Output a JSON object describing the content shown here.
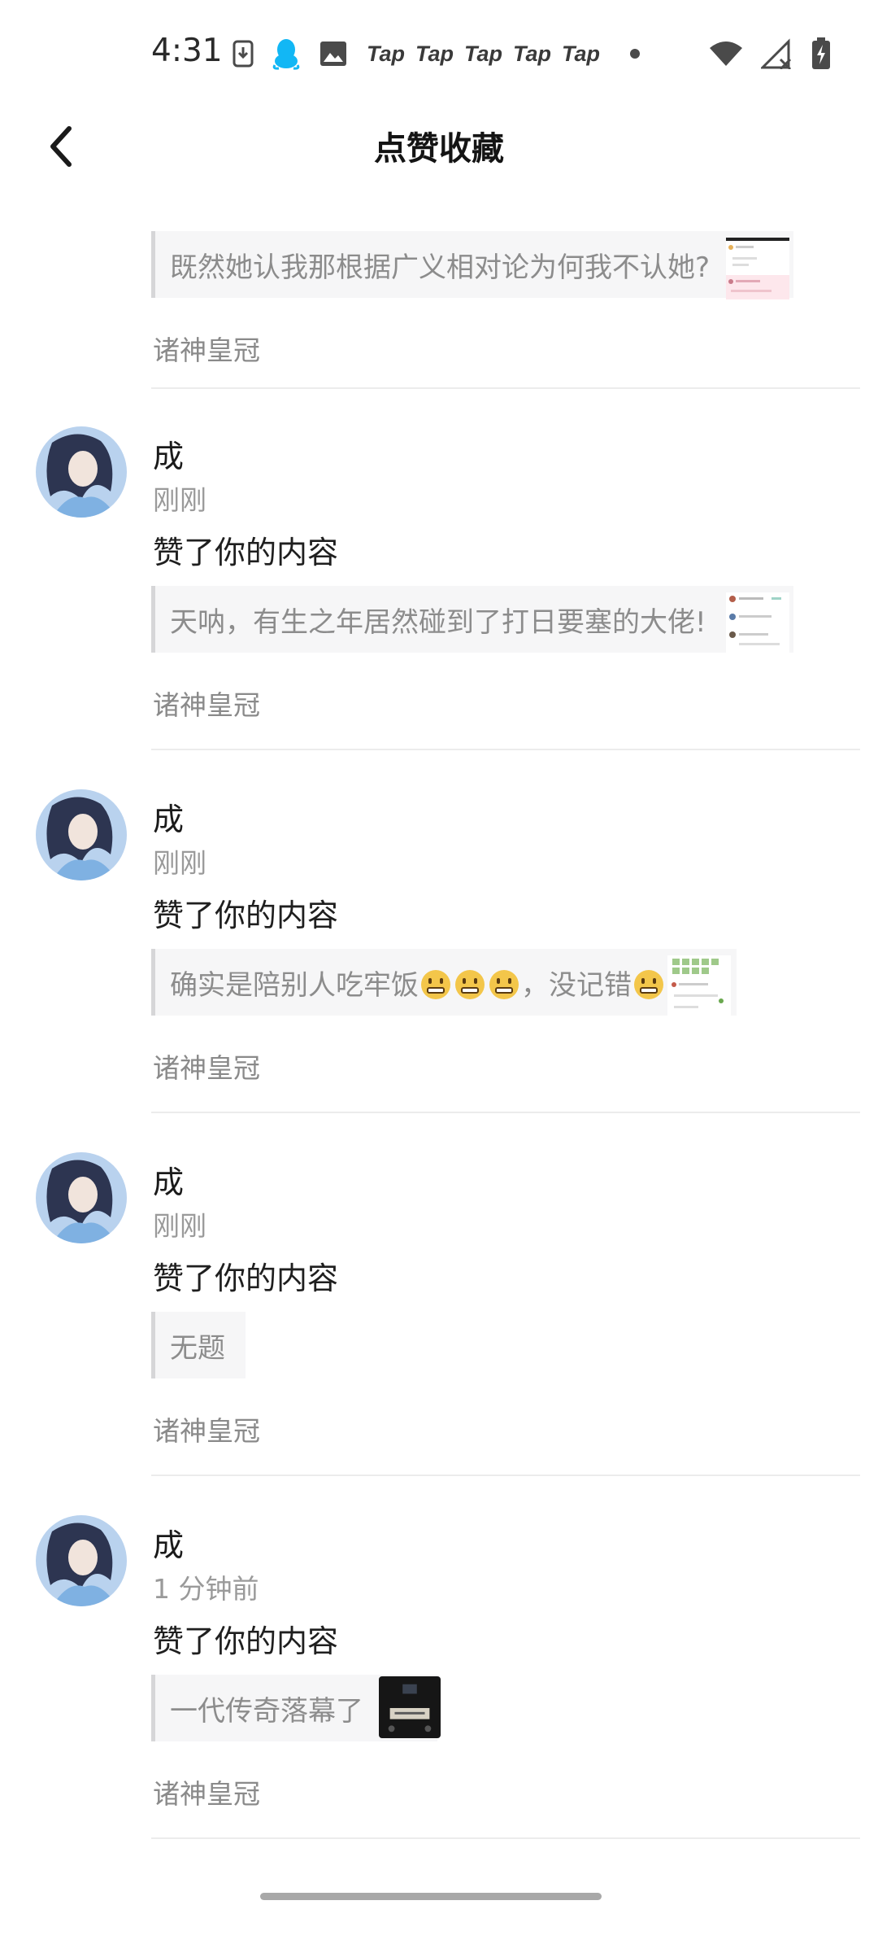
{
  "status_bar": {
    "time": "4:31",
    "tap_labels": [
      "Tap",
      "Tap",
      "Tap",
      "Tap",
      "Tap"
    ],
    "icons": [
      "download-icon",
      "qq-penguin-icon",
      "image-icon",
      "wifi-icon",
      "no-signal-icon",
      "battery-charging-icon"
    ]
  },
  "app_bar": {
    "title": "点赞收藏",
    "back_icon": "chevron-left-icon"
  },
  "colors": {
    "background": "#ffffff",
    "quote_bg": "#f6f6f7",
    "quote_bar": "#d6d6d8",
    "muted_text": "#9a9a9a"
  },
  "items": [
    {
      "quote": "既然她认我那根据广义相对论为何我不认她?",
      "source": "诸神皇冠"
    },
    {
      "name": "成",
      "time": "刚刚",
      "action": "赞了你的内容",
      "quote": "天呐，有生之年居然碰到了打日要塞的大佬!",
      "source": "诸神皇冠"
    },
    {
      "name": "成",
      "time": "刚刚",
      "action": "赞了你的内容",
      "quote_a": "确实是陪别人吃牢饭",
      "quote_b": "，没记错",
      "source": "诸神皇冠",
      "emoji": "grimacing-face-emoji"
    },
    {
      "name": "成",
      "time": "刚刚",
      "action": "赞了你的内容",
      "quote": "无题",
      "source": "诸神皇冠"
    },
    {
      "name": "成",
      "time": "1 分钟前",
      "action": "赞了你的内容",
      "quote": "一代传奇落幕了",
      "source": "诸神皇冠"
    }
  ]
}
